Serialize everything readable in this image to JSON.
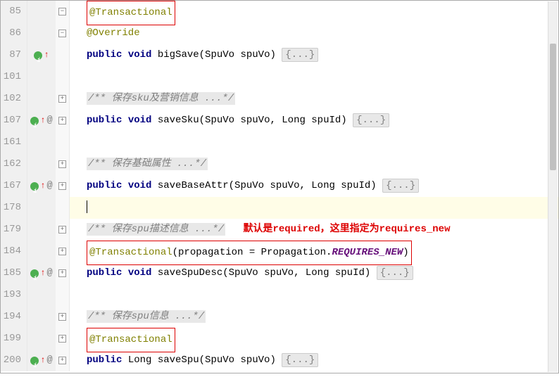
{
  "lines": [
    {
      "num": "85",
      "marker": "",
      "fold": "minus",
      "code_parts": [
        {
          "t": "ann",
          "v": "@Transactional",
          "box": true
        }
      ]
    },
    {
      "num": "86",
      "marker": "",
      "fold": "minus",
      "code_parts": [
        {
          "t": "ann",
          "v": "@Override"
        }
      ]
    },
    {
      "num": "87",
      "marker": "dot-arrow",
      "fold": "",
      "code_parts": [
        {
          "t": "kw",
          "v": "public"
        },
        {
          "t": "txt",
          "v": " "
        },
        {
          "t": "kw",
          "v": "void"
        },
        {
          "t": "txt",
          "v": " bigSave(SpuVo spuVo) "
        },
        {
          "t": "fold",
          "v": "{...}"
        }
      ]
    },
    {
      "num": "101",
      "marker": "",
      "fold": "",
      "code_parts": []
    },
    {
      "num": "102",
      "marker": "",
      "fold": "plus",
      "code_parts": [
        {
          "t": "com",
          "v": "/** 保存sku及营销信息 ...*/"
        }
      ]
    },
    {
      "num": "107",
      "marker": "dot-arrow-at",
      "fold": "plus",
      "code_parts": [
        {
          "t": "kw",
          "v": "public"
        },
        {
          "t": "txt",
          "v": " "
        },
        {
          "t": "kw",
          "v": "void"
        },
        {
          "t": "txt",
          "v": " saveSku(SpuVo spuVo, Long spuId) "
        },
        {
          "t": "fold",
          "v": "{...}"
        }
      ]
    },
    {
      "num": "161",
      "marker": "",
      "fold": "",
      "code_parts": []
    },
    {
      "num": "162",
      "marker": "",
      "fold": "plus",
      "code_parts": [
        {
          "t": "com",
          "v": "/** 保存基础属性 ...*/"
        }
      ]
    },
    {
      "num": "167",
      "marker": "dot-arrow-at",
      "fold": "plus",
      "code_parts": [
        {
          "t": "kw",
          "v": "public"
        },
        {
          "t": "txt",
          "v": " "
        },
        {
          "t": "kw",
          "v": "void"
        },
        {
          "t": "txt",
          "v": " saveBaseAttr(SpuVo spuVo, Long spuId) "
        },
        {
          "t": "fold",
          "v": "{...}"
        }
      ]
    },
    {
      "num": "178",
      "marker": "",
      "fold": "",
      "hl": true,
      "cursor": true,
      "code_parts": []
    },
    {
      "num": "179",
      "marker": "",
      "fold": "plus",
      "code_parts": [
        {
          "t": "com",
          "v": "/** 保存spu描述信息 ...*/"
        },
        {
          "t": "txt",
          "v": "   "
        },
        {
          "t": "red",
          "v": "默认是required，这里指定为requires_new"
        }
      ]
    },
    {
      "num": "184",
      "marker": "",
      "fold": "plus",
      "code_parts": [
        {
          "t": "boxstart",
          "v": ""
        },
        {
          "t": "ann",
          "v": "@Transactional"
        },
        {
          "t": "txt",
          "v": "(propagation = Propagation."
        },
        {
          "t": "enum",
          "v": "REQUIRES_NEW"
        },
        {
          "t": "txt",
          "v": ")"
        },
        {
          "t": "boxend",
          "v": ""
        }
      ]
    },
    {
      "num": "185",
      "marker": "dot-arrow-at",
      "fold": "plus",
      "code_parts": [
        {
          "t": "kw",
          "v": "public"
        },
        {
          "t": "txt",
          "v": " "
        },
        {
          "t": "kw",
          "v": "void"
        },
        {
          "t": "txt",
          "v": " saveSpuDesc(SpuVo spuVo, Long spuId) "
        },
        {
          "t": "fold",
          "v": "{...}"
        }
      ]
    },
    {
      "num": "193",
      "marker": "",
      "fold": "",
      "code_parts": []
    },
    {
      "num": "194",
      "marker": "",
      "fold": "plus",
      "code_parts": [
        {
          "t": "com",
          "v": "/** 保存spu信息 ...*/"
        }
      ]
    },
    {
      "num": "199",
      "marker": "",
      "fold": "plus",
      "code_parts": [
        {
          "t": "ann",
          "v": "@Transactional",
          "box": true
        }
      ]
    },
    {
      "num": "200",
      "marker": "dot-arrow-at",
      "fold": "plus",
      "code_parts": [
        {
          "t": "kw",
          "v": "public"
        },
        {
          "t": "txt",
          "v": " Long saveSpu(SpuVo spuVo) "
        },
        {
          "t": "fold",
          "v": "{...}"
        }
      ]
    }
  ]
}
